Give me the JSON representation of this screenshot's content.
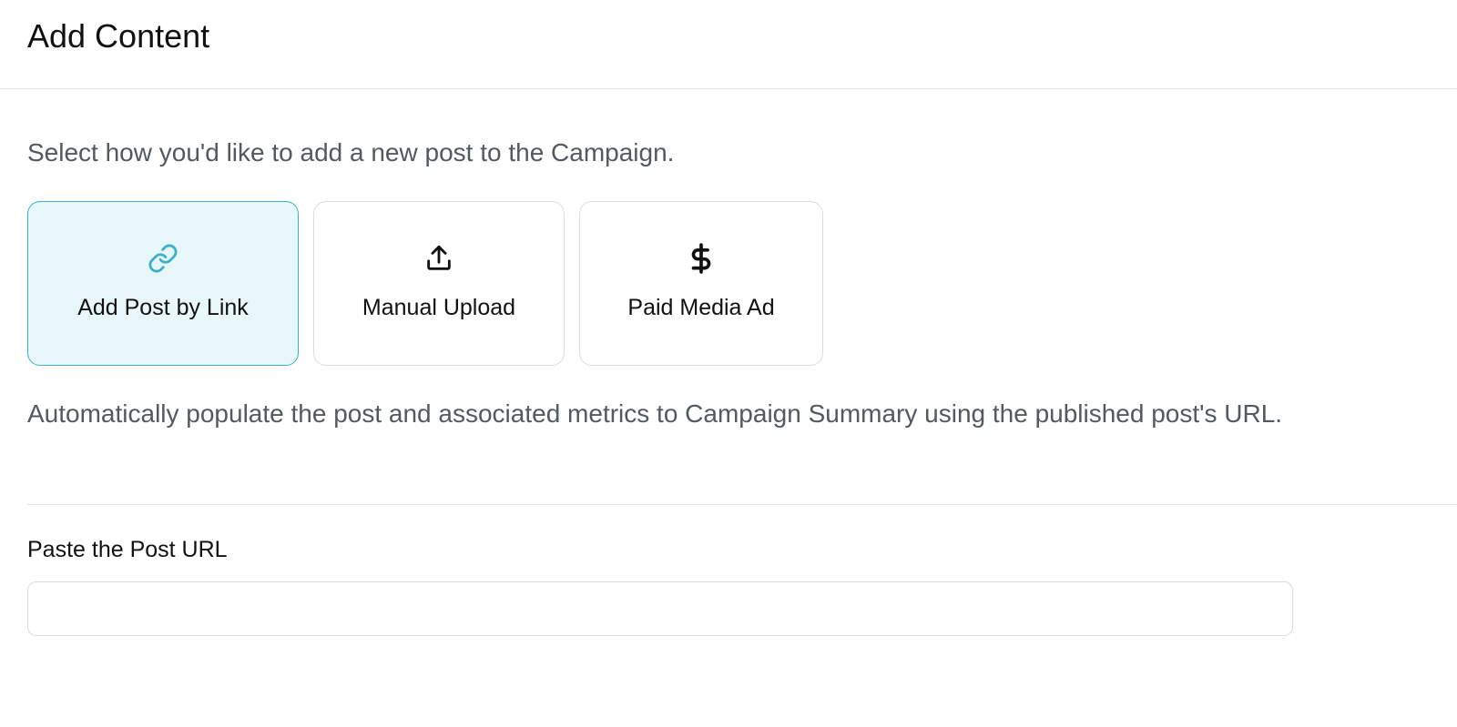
{
  "header": {
    "title": "Add Content"
  },
  "intro_text": "Select how you'd like to add a new post to the Campaign.",
  "options": [
    {
      "label": "Add Post by Link",
      "icon": "link-icon",
      "selected": true,
      "icon_color": "#3bb0c8"
    },
    {
      "label": "Manual Upload",
      "icon": "upload-icon",
      "selected": false,
      "icon_color": "#111111"
    },
    {
      "label": "Paid Media Ad",
      "icon": "dollar-icon",
      "selected": false,
      "icon_color": "#111111"
    }
  ],
  "description": "Automatically populate the post and associated metrics to Campaign Summary using the published post's URL.",
  "url_field": {
    "label": "Paste the Post URL",
    "value": "",
    "placeholder": ""
  },
  "colors": {
    "accent": "#3bb0c8",
    "selected_background": "#e8f8fa",
    "muted_text": "#525a60",
    "border": "#dcdcdc"
  }
}
